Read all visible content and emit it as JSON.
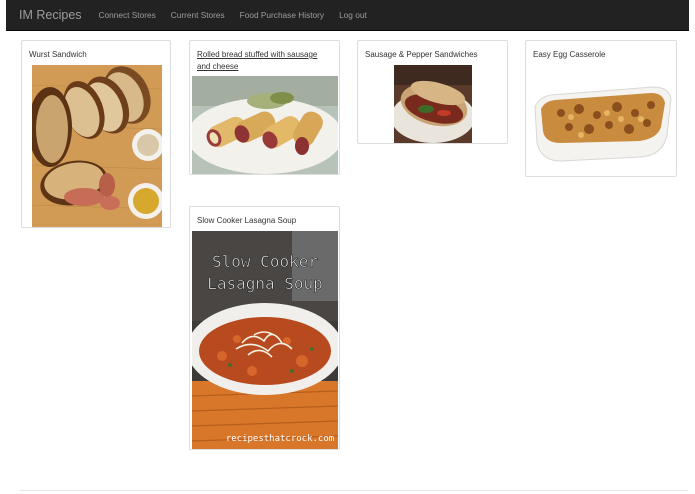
{
  "navbar": {
    "brand": "IM Recipes",
    "links": [
      {
        "label": "Connect Stores"
      },
      {
        "label": "Current Stores"
      },
      {
        "label": "Food Purchase History"
      },
      {
        "label": "Log out"
      }
    ]
  },
  "recipes": [
    {
      "title": "Wurst Sandwich"
    },
    {
      "title": "Rolled bread stuffed with sausage and cheese"
    },
    {
      "title": "Sausage & Pepper Sandwiches"
    },
    {
      "title": "Easy Egg Casserole"
    },
    {
      "title": "Slow Cooker Lasagna Soup",
      "image_caption_line1": "Slow Cooker",
      "image_caption_line2": "Lasagna Soup",
      "image_watermark": "recipesthatcrock.com"
    }
  ]
}
